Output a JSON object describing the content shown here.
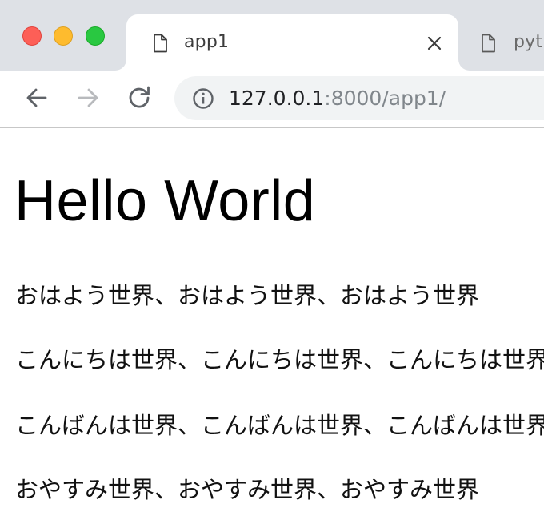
{
  "browser": {
    "tabs": [
      {
        "title": "app1",
        "active": true
      },
      {
        "title": "pyt",
        "active": false
      }
    ],
    "url": {
      "host": "127.0.0.1",
      "rest": ":8000/app1/"
    },
    "icons": {
      "page": "page-icon",
      "close": "close-icon",
      "back": "back-arrow-icon",
      "forward": "forward-arrow-icon",
      "reload": "reload-icon",
      "info": "info-icon"
    },
    "colors": {
      "tabstrip": "#dee1e6",
      "omnibox": "#f1f3f4",
      "traffic_close": "#fd5f57",
      "traffic_min": "#febb2e",
      "traffic_max": "#29c841"
    }
  },
  "page": {
    "heading": "Hello World",
    "paragraphs": [
      "おはよう世界、おはよう世界、おはよう世界",
      "こんにちは世界、こんにちは世界、こんにちは世界",
      "こんばんは世界、こんばんは世界、こんばんは世界",
      "おやすみ世界、おやすみ世界、おやすみ世界"
    ]
  }
}
